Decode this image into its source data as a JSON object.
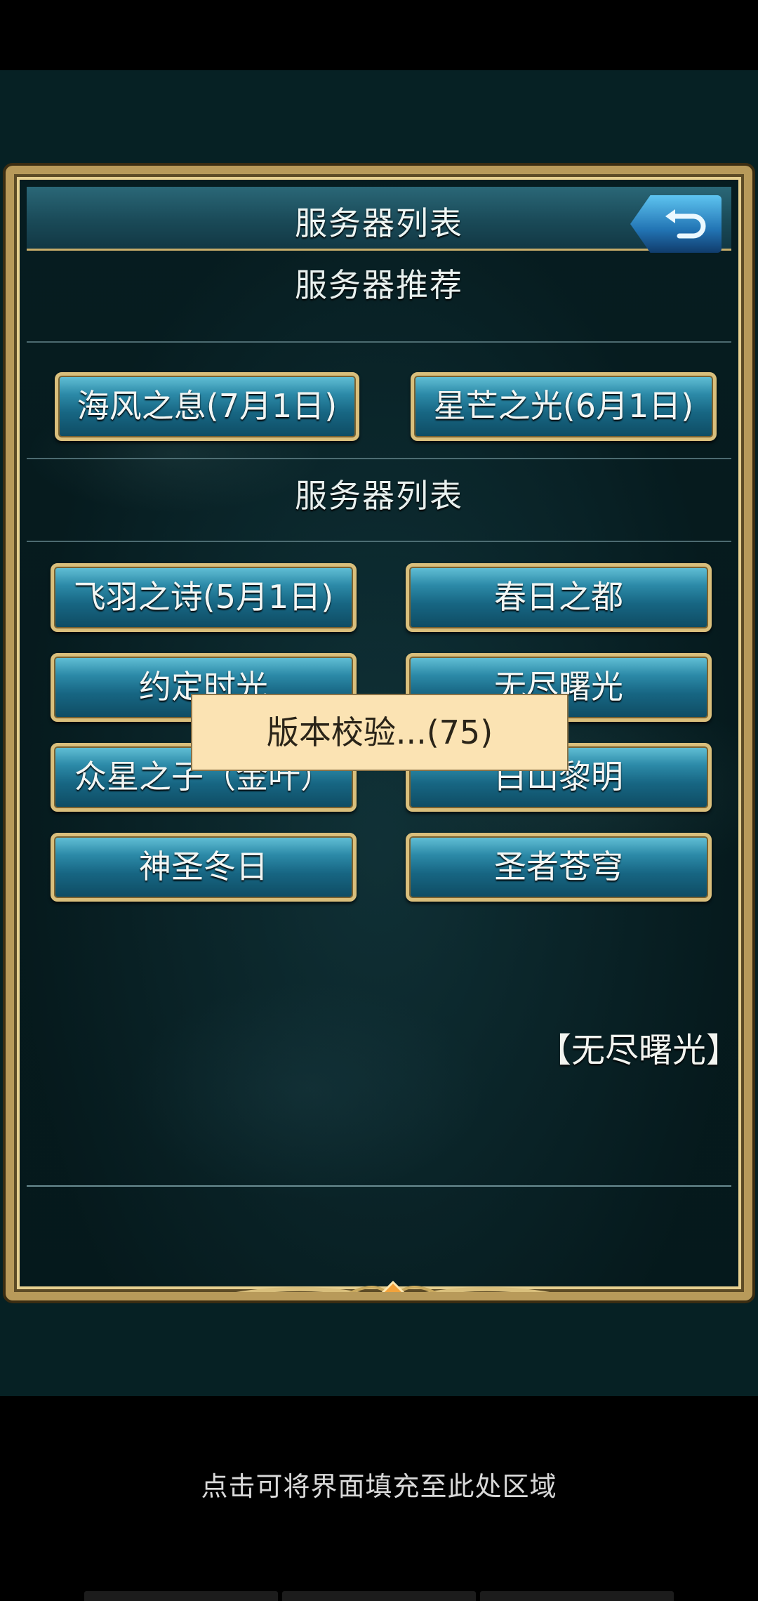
{
  "header": {
    "title": "服务器列表"
  },
  "recommended": {
    "title": "服务器推荐",
    "servers": [
      "海风之息(7月1日)",
      "星芒之光(6月1日)"
    ]
  },
  "server_list": {
    "title": "服务器列表",
    "servers": [
      "飞羽之诗(5月1日)",
      "春日之都",
      "约定时光",
      "无尽曙光",
      "众星之子（金叶）",
      "白山黎明",
      "神圣冬日",
      "圣者苍穹"
    ]
  },
  "current_server": "【无尽曙光】",
  "popup": {
    "text": "版本校验...(75)"
  },
  "hint": "点击可将界面填充至此处区域",
  "colors": {
    "accent_gold": "#d9bf7c",
    "button_blue": "#176683",
    "popup_bg": "#fbe3b3"
  }
}
